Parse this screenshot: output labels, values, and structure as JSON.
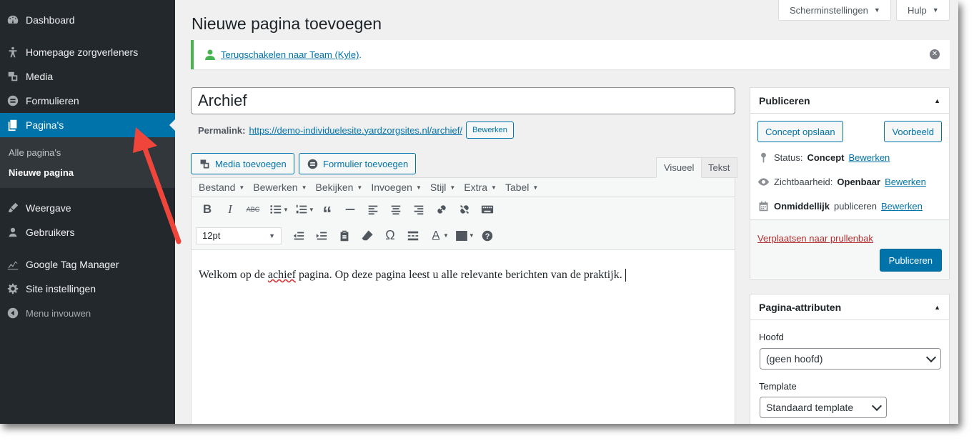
{
  "sidebar": {
    "items": [
      {
        "label": "Dashboard",
        "icon": "dashboard-icon"
      },
      {
        "label": "Homepage zorgverleners",
        "icon": "pin-icon"
      },
      {
        "label": "Media",
        "icon": "media-icon"
      },
      {
        "label": "Formulieren",
        "icon": "forms-icon"
      },
      {
        "label": "Pagina's",
        "icon": "pages-icon"
      },
      {
        "label": "Weergave",
        "icon": "appearance-icon"
      },
      {
        "label": "Gebruikers",
        "icon": "users-icon"
      },
      {
        "label": "Google Tag Manager",
        "icon": "chart-icon"
      },
      {
        "label": "Site instellingen",
        "icon": "settings-icon"
      },
      {
        "label": "Menu invouwen",
        "icon": "collapse-icon"
      }
    ],
    "submenu": [
      "Alle pagina's",
      "Nieuwe pagina"
    ]
  },
  "top": {
    "screen_options": "Scherminstellingen",
    "help": "Hulp"
  },
  "page_title": "Nieuwe pagina toevoegen",
  "notice": {
    "link": "Terugschakelen naar Team (Kyle)",
    "suffix": "."
  },
  "post": {
    "title": "Archief",
    "permalink_label": "Permalink:",
    "permalink_base": "https://demo-individuelesite.yardzorgsites.nl/",
    "permalink_slug": "archief",
    "permalink_trail": "/",
    "edit_button": "Bewerken"
  },
  "editor": {
    "add_media": "Media toevoegen",
    "add_form": "Formulier toevoegen",
    "tab_visual": "Visueel",
    "tab_text": "Tekst",
    "menubar": [
      "Bestand",
      "Bewerken",
      "Bekijken",
      "Invoegen",
      "Stijl",
      "Extra",
      "Tabel"
    ],
    "font_size": "12pt",
    "content_before": "Welkom op de ",
    "content_misspelled": "achief",
    "content_after": " pagina. Op deze pagina leest u alle relevante berichten van de praktijk."
  },
  "publish": {
    "title": "Publiceren",
    "save_draft": "Concept opslaan",
    "preview": "Voorbeeld",
    "status_label": "Status:",
    "status_value": "Concept",
    "visibility_label": "Zichtbaarheid:",
    "visibility_value": "Openbaar",
    "schedule_value": "Onmiddellijk",
    "schedule_suffix": "publiceren",
    "edit_link": "Bewerken",
    "trash": "Verplaatsen naar prullenbak",
    "publish_button": "Publiceren"
  },
  "attributes": {
    "title": "Pagina-attributen",
    "parent_label": "Hoofd",
    "parent_value": "(geen hoofd)",
    "template_label": "Template",
    "template_value": "Standaard template"
  },
  "colors": {
    "sidebar_bg": "#23282d",
    "accent": "#0073aa",
    "notice_success": "#46b450",
    "annotation_arrow": "#f0453a"
  }
}
